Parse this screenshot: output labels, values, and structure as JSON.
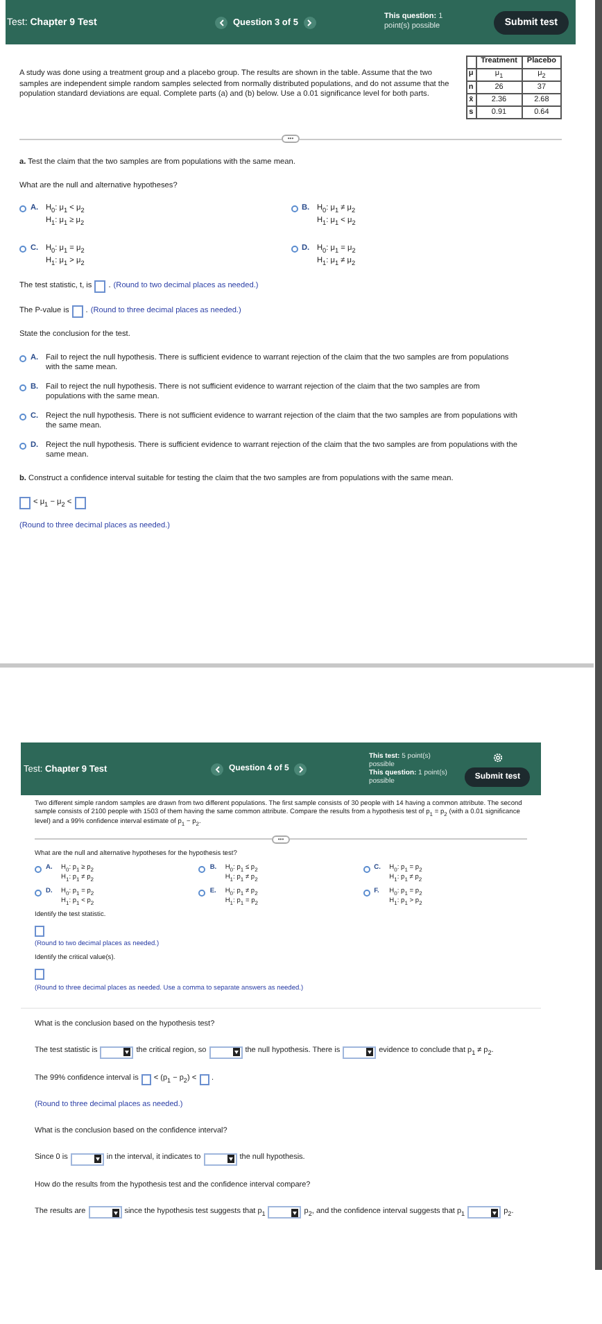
{
  "panels": [
    {
      "header": {
        "title": "Test: **Chapter 9 Test**",
        "question": "Question 3 of 5",
        "points": [
          "**This question:** 1 point(s) possible"
        ],
        "settings_icon": false,
        "submit": "Submit test"
      },
      "blocks": [
        {
          "kind": "intro",
          "text": "A study was done using a treatment group and a placebo group. The results are shown in the table. Assume that the two samples are independent simple random samples selected from normally distributed populations, and do not assume that the population standard deviations are equal. Complete parts (a) and (b) below. Use a 0.01 significance level for both parts.",
          "table": {
            "columns": [
              "Treatment",
              "Placebo"
            ],
            "rows": [
              {
                "label": "μ",
                "cells": [
                  "μ$_{1}$",
                  "μ$_{2}$"
                ]
              },
              {
                "label": "n",
                "cells": [
                  "26",
                  "37"
                ]
              },
              {
                "label": "x̄",
                "cells": [
                  "2.36",
                  "2.68"
                ]
              },
              {
                "label": "s",
                "cells": [
                  "0.91",
                  "0.64"
                ]
              }
            ]
          }
        },
        {
          "kind": "divider",
          "label": "•••"
        },
        {
          "kind": "text",
          "text": "**a.** Test the claim that the two samples are from populations with the same mean."
        },
        {
          "kind": "text",
          "text": "What are the null and alternative hypotheses?"
        },
        {
          "kind": "options",
          "items": [
            {
              "letter": "A.",
              "lines": [
                "H$_{0}$: μ$_{1}$ < μ$_{2}$",
                "H$_{1}$: μ$_{1}$ ≥ μ$_{2}$"
              ],
              "selected": false
            },
            {
              "letter": "B.",
              "lines": [
                "H$_{0}$: μ$_{1}$ ≠ μ$_{2}$",
                "H$_{1}$: μ$_{1}$ < μ$_{2}$"
              ],
              "selected": false
            },
            {
              "letter": "C.",
              "lines": [
                "H$_{0}$: μ$_{1}$ = μ$_{2}$",
                "H$_{1}$: μ$_{1}$ > μ$_{2}$"
              ],
              "selected": false
            },
            {
              "letter": "D.",
              "lines": [
                "H$_{0}$: μ$_{1}$ = μ$_{2}$",
                "H$_{1}$: μ$_{1}$ ≠ μ$_{2}$"
              ],
              "selected": false
            }
          ]
        },
        {
          "kind": "sentence",
          "segments": [
            {
              "kind": "text",
              "text": "The test statistic, t, is"
            },
            {
              "kind": "box"
            },
            {
              "kind": "text",
              "text": "."
            },
            {
              "kind": "hint",
              "text": "(Round to two decimal places as needed.)"
            }
          ]
        },
        {
          "kind": "sentence",
          "segments": [
            {
              "kind": "text",
              "text": "The P-value is"
            },
            {
              "kind": "box"
            },
            {
              "kind": "text",
              "text": "."
            },
            {
              "kind": "hint",
              "text": "(Round to three decimal places as needed.)"
            }
          ]
        },
        {
          "kind": "text",
          "text": "State the conclusion for the test."
        },
        {
          "kind": "choices",
          "items": [
            {
              "letter": "A.",
              "lines": [
                "Fail to reject the null hypothesis. There is sufficient evidence to warrant rejection of the claim that the two samples are from populations with the same mean."
              ],
              "selected": false
            },
            {
              "letter": "B.",
              "lines": [
                "Fail to reject the null hypothesis. There is not sufficient evidence to warrant rejection of the claim that the two samples are from populations with the same mean."
              ],
              "selected": false
            },
            {
              "letter": "C.",
              "lines": [
                "Reject the null hypothesis. There is not sufficient evidence to warrant rejection of the claim that the two samples are from populations with the same mean."
              ],
              "selected": false
            },
            {
              "letter": "D.",
              "lines": [
                "Reject the null hypothesis. There is sufficient evidence to warrant rejection of the claim that the two samples are from populations with the same mean."
              ],
              "selected": false
            }
          ]
        },
        {
          "kind": "text",
          "text": "**b.** Construct a confidence interval suitable for testing the claim that the two samples are from populations with the same mean."
        },
        {
          "kind": "sentence",
          "segments": [
            {
              "kind": "box"
            },
            {
              "kind": "text",
              "text": "< μ$_{1}$ − μ$_{2}$ <"
            },
            {
              "kind": "box"
            }
          ]
        },
        {
          "kind": "hint",
          "text": "(Round to three decimal places as needed.)"
        }
      ]
    },
    {
      "header": {
        "title": "Test: **Chapter 9 Test**",
        "question": "Question 4 of 5",
        "points": [
          "**This test:** 5 point(s) possible",
          "**This question:** 1 point(s) possible"
        ],
        "settings_icon": true,
        "submit": "Submit test"
      },
      "blocks": [
        {
          "kind": "text",
          "text": "Two different simple random samples are drawn from two different populations. The first sample consists of 30 people with 14 having a common attribute. The second sample consists of 2100 people with 1503 of them having the same common attribute. Compare the results from a hypothesis test of p$_{1}$ = p$_{2}$ (with a 0.01 significance level) and a 99% confidence interval estimate of p$_{1}$ − p$_{2}$."
        },
        {
          "kind": "divider",
          "label": "•••"
        },
        {
          "kind": "text",
          "text": "What are the null and alternative hypotheses for the hypothesis test?"
        },
        {
          "kind": "options",
          "items": [
            {
              "letter": "A.",
              "lines": [
                "H$_{0}$: p$_{1}$ ≥ p$_{2}$",
                "H$_{1}$: p$_{1}$ ≠ p$_{2}$"
              ],
              "selected": false
            },
            {
              "letter": "B.",
              "lines": [
                "H$_{0}$: p$_{1}$ ≤ p$_{2}$",
                "H$_{1}$: p$_{1}$ ≠ p$_{2}$"
              ],
              "selected": false
            },
            {
              "letter": "C.",
              "lines": [
                "H$_{0}$: p$_{1}$ = p$_{2}$",
                "H$_{1}$: p$_{1}$ ≠ p$_{2}$"
              ],
              "selected": false
            },
            {
              "letter": "D.",
              "lines": [
                "H$_{0}$: p$_{1}$ = p$_{2}$",
                "H$_{1}$: p$_{1}$ < p$_{2}$"
              ],
              "selected": false
            },
            {
              "letter": "E.",
              "lines": [
                "H$_{0}$: p$_{1}$ ≠ p$_{2}$",
                "H$_{1}$: p$_{1}$ = p$_{2}$"
              ],
              "selected": false
            },
            {
              "letter": "F.",
              "lines": [
                "H$_{0}$: p$_{1}$ = p$_{2}$",
                "H$_{1}$: p$_{1}$ > p$_{2}$"
              ],
              "selected": false
            }
          ]
        },
        {
          "kind": "text",
          "text": "Identify the test statistic."
        },
        {
          "kind": "sentence",
          "segments": [
            {
              "kind": "box"
            }
          ]
        },
        {
          "kind": "hint",
          "text": "(Round to two decimal places as needed.)"
        },
        {
          "kind": "text",
          "text": "Identify the critical value(s)."
        },
        {
          "kind": "sentence",
          "segments": [
            {
              "kind": "box"
            }
          ]
        },
        {
          "kind": "hint",
          "text": "(Round to three decimal places as needed. Use a comma to separate answers as needed.)"
        }
      ],
      "lower_blocks": [
        {
          "kind": "text",
          "text": "What is the conclusion based on the hypothesis test?"
        },
        {
          "kind": "sentence",
          "segments": [
            {
              "kind": "text",
              "text": "The test statistic is"
            },
            {
              "kind": "dropdown"
            },
            {
              "kind": "text",
              "text": "the critical region, so"
            },
            {
              "kind": "dropdown"
            },
            {
              "kind": "text",
              "text": "the null hypothesis. There is"
            },
            {
              "kind": "dropdown"
            },
            {
              "kind": "text",
              "text": "evidence to conclude that p$_{1}$ ≠ p$_{2}$."
            }
          ]
        },
        {
          "kind": "sentence",
          "segments": [
            {
              "kind": "text",
              "text": "The 99% confidence interval is"
            },
            {
              "kind": "box"
            },
            {
              "kind": "text",
              "text": "< (p$_{1}$ − p$_{2}$) <"
            },
            {
              "kind": "box"
            },
            {
              "kind": "text",
              "text": "."
            }
          ]
        },
        {
          "kind": "hint",
          "text": "(Round to three decimal places as needed.)"
        },
        {
          "kind": "text",
          "text": "What is the conclusion based on the confidence interval?"
        },
        {
          "kind": "sentence",
          "segments": [
            {
              "kind": "text",
              "text": "Since 0 is"
            },
            {
              "kind": "dropdown"
            },
            {
              "kind": "text",
              "text": "in the interval, it indicates to"
            },
            {
              "kind": "dropdown"
            },
            {
              "kind": "text",
              "text": "the null hypothesis."
            }
          ]
        },
        {
          "kind": "text",
          "text": "How do the results from the hypothesis test and the confidence interval compare?"
        },
        {
          "kind": "sentence",
          "segments": [
            {
              "kind": "text",
              "text": "The results are"
            },
            {
              "kind": "dropdown"
            },
            {
              "kind": "text",
              "text": "since the hypothesis test suggests that p$_{1}$"
            },
            {
              "kind": "dropdown"
            },
            {
              "kind": "text",
              "text": "p$_{2}$, and the confidence interval suggests that p$_{1}$"
            },
            {
              "kind": "dropdown"
            },
            {
              "kind": "text",
              "text": "p$_{2}$."
            }
          ]
        }
      ]
    }
  ]
}
